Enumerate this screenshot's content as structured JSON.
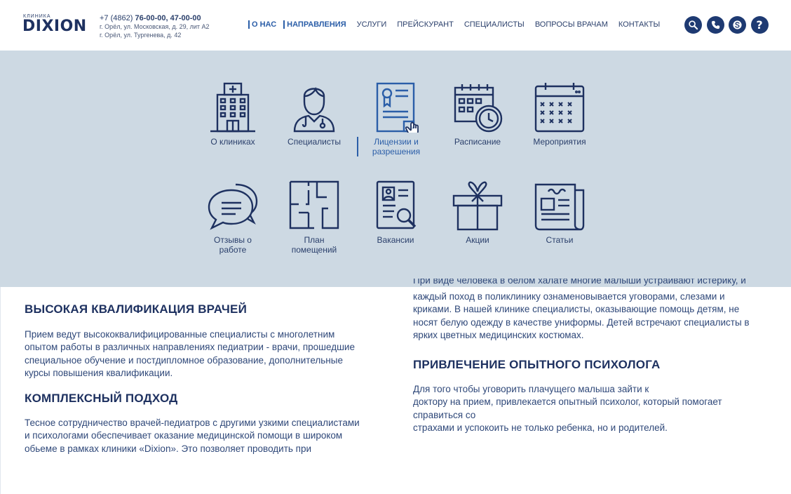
{
  "header": {
    "logo_small": "КЛИНИКА",
    "logo_big": "DIXION",
    "phone_prefix": "+7 (4862) ",
    "phone_numbers": "76-00-00, 47-00-00",
    "address_1": "г. Орёл, ул. Московская, д. 29, лит А2",
    "address_2": "г. Орёл, ул. Тургенева, д. 42"
  },
  "nav": {
    "items": [
      {
        "label": "О НАС"
      },
      {
        "label": "НАПРАВЛЕНИЯ"
      },
      {
        "label": "УСЛУГИ"
      },
      {
        "label": "ПРЕЙСКУРАНТ"
      },
      {
        "label": "СПЕЦИАЛИСТЫ"
      },
      {
        "label": "ВОПРОСЫ ВРАЧАМ"
      },
      {
        "label": "КОНТАКТЫ"
      }
    ]
  },
  "header_icons": [
    "search-icon",
    "phone-icon",
    "skype-icon",
    "help-icon"
  ],
  "mega_menu": {
    "items": [
      {
        "label": "О клиниках",
        "icon": "hospital-icon"
      },
      {
        "label": "Специалисты",
        "icon": "doctor-icon"
      },
      {
        "label_line1": "Лицензии и",
        "label_line2": "разрешения",
        "icon": "license-icon"
      },
      {
        "label": "Расписание",
        "icon": "schedule-icon"
      },
      {
        "label": "Мероприятия",
        "icon": "calendar-icon"
      },
      {
        "label_line1": "Отзывы о",
        "label_line2": "работе",
        "icon": "reviews-icon"
      },
      {
        "label_line1": "План",
        "label_line2": "помещений",
        "icon": "floor-plan-icon"
      },
      {
        "label": "Вакансии",
        "icon": "vacancies-icon"
      },
      {
        "label": "Акции",
        "icon": "gift-icon"
      },
      {
        "label": "Статьи",
        "icon": "newspaper-icon"
      }
    ]
  },
  "content": {
    "left": [
      {
        "heading": "ВЫСОКАЯ КВАЛИФИКАЦИЯ ВРАЧЕЙ",
        "lines": [
          "Прием ведут высококвалифицированные специалисты с многолетним",
          "опытом работы в различных направлениях педиатрии - врачи, прошедшие",
          "специальное обучение и  постдипломное образование,  дополнительные",
          "курсы повышения квалификации."
        ]
      },
      {
        "heading": "КОМПЛЕКСНЫЙ ПОДХОД",
        "lines": [
          "Тесное сотрудничество врачей-педиатров с другими узкими специалистами",
          "и  психологами обеспечивает оказание медицинской помощи в широком",
          "обьеме в рамках клиники «Dixion». Это позволяет проводить при"
        ]
      }
    ],
    "right_cut_line": "При виде  человека в белом халате многие малыши устраивают истерику, и",
    "right_para_lines": [
      "каждый поход в поликлинику ознаменовывается уговорами, слезами и",
      "криками. В нашей клинике специалисты, оказывающие помощь детям, не",
      "носят белую одежду в качестве униформы. Детей встречают специалисты в",
      "ярких цветных медицинских костюмах."
    ],
    "right_section": {
      "heading": "ПРИВЛЕЧЕНИЕ ОПЫТНОГО ПСИХОЛОГА",
      "lines": [
        "Для того чтобы уговорить плачущего малыша зайти к",
        "доктору на прием, привлекается опытный психолог, который помогает",
        "справиться со",
        "страхами и успокоить не только ребенка, но и родителей."
      ]
    }
  },
  "colors": {
    "brand_dark": "#1e3160",
    "accent": "#2b5ea8",
    "menu_bg": "#cdd9e3",
    "icon_dark": "#1e3a72"
  }
}
